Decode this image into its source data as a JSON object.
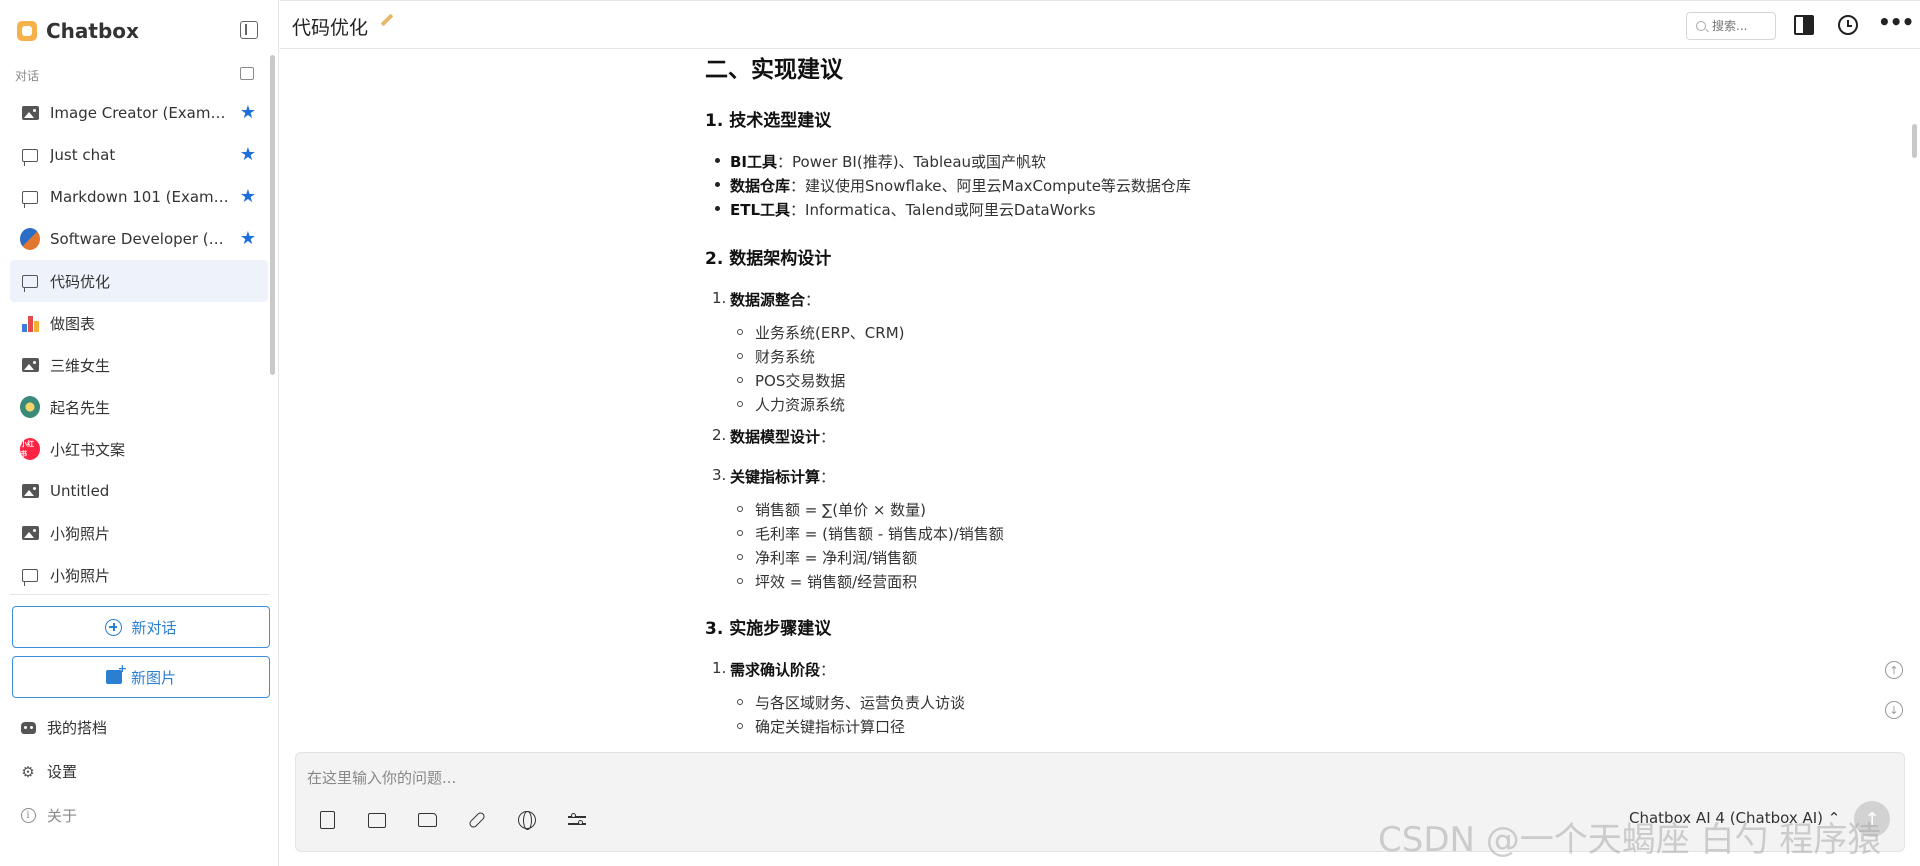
{
  "app": {
    "name": "Chatbox"
  },
  "sidebar": {
    "section_label": "对话",
    "conversations": [
      {
        "label": "Image Creator (Examp…",
        "icon": "image-icon",
        "starred": true
      },
      {
        "label": "Just chat",
        "icon": "chat-icon",
        "starred": true
      },
      {
        "label": "Markdown 101 (Exam…",
        "icon": "chat-icon",
        "starred": true
      },
      {
        "label": "Software Developer (…",
        "icon": "avatar-icon",
        "starred": true
      },
      {
        "label": "代码优化",
        "icon": "chat-icon",
        "starred": false,
        "active": true
      },
      {
        "label": "做图表",
        "icon": "chart-avatar-icon",
        "starred": false
      },
      {
        "label": "三维女生",
        "icon": "image-icon",
        "starred": false
      },
      {
        "label": "起名先生",
        "icon": "avatar-icon",
        "starred": false
      },
      {
        "label": "小红书文案",
        "icon": "xiaohongshu-icon",
        "starred": false
      },
      {
        "label": "Untitled",
        "icon": "image-icon",
        "starred": false
      },
      {
        "label": "小狗照片",
        "icon": "image-icon",
        "starred": false
      },
      {
        "label": "小狗照片",
        "icon": "chat-icon",
        "starred": false
      }
    ],
    "new_chat_label": "新对话",
    "new_image_label": "新图片",
    "my_copilots_label": "我的搭档",
    "settings_label": "设置",
    "about_label": "关于",
    "xhs_badge": "小红书"
  },
  "header": {
    "title": "代码优化",
    "search_placeholder": "搜索..."
  },
  "content": {
    "h2": "二、实现建议",
    "s1": {
      "title": "1. 技术选型建议",
      "items": [
        {
          "bold": "BI工具",
          "text": "：Power BI(推荐)、Tableau或国产帆软"
        },
        {
          "bold": "数据仓库",
          "text": "：建议使用Snowflake、阿里云MaxCompute等云数据仓库"
        },
        {
          "bold": "ETL工具",
          "text": "：Informatica、Talend或阿里云DataWorks"
        }
      ]
    },
    "s2": {
      "title": "2. 数据架构设计",
      "n1": {
        "num": "1.",
        "bold": "数据源整合",
        "colon": "：",
        "subs": [
          "业务系统(ERP、CRM)",
          "财务系统",
          "POS交易数据",
          "人力资源系统"
        ]
      },
      "n2": {
        "num": "2.",
        "bold": "数据模型设计",
        "colon": "："
      },
      "n3": {
        "num": "3.",
        "bold": "关键指标计算",
        "colon": "：",
        "subs": [
          "销售额 = ∑(单价 × 数量)",
          "毛利率 = (销售额 - 销售成本)/销售额",
          "净利率 = 净利润/销售额",
          "坪效 = 销售额/经营面积"
        ]
      }
    },
    "s3": {
      "title": "3. 实施步骤建议",
      "n1": {
        "num": "1.",
        "bold": "需求确认阶段",
        "colon": "：",
        "subs": [
          "与各区域财务、运营负责人访谈",
          "确定关键指标计算口径"
        ]
      }
    }
  },
  "input": {
    "placeholder": "在这里输入你的问题...",
    "model": "Chatbox AI 4 (Chatbox AI) ⌃"
  },
  "watermark": "CSDN @一个天蝎座 白勺 程序猿"
}
